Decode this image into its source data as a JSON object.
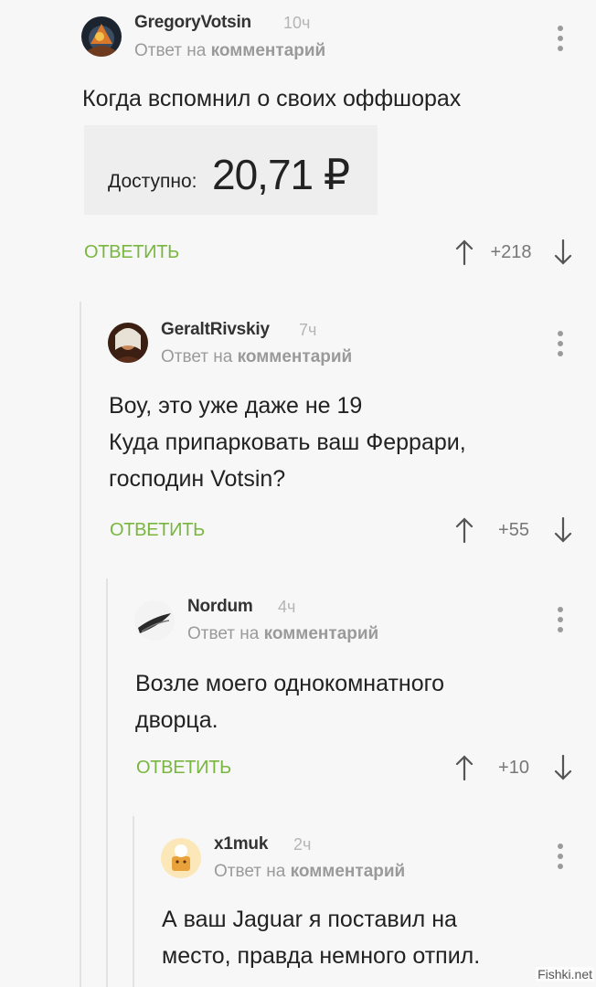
{
  "comments": [
    {
      "username": "GregoryVotsin",
      "time": "10ч",
      "reply_prefix": "Ответ на",
      "reply_target": "комментарий",
      "text_lines": [
        "Когда вспомнил о своих оффшорах"
      ],
      "reply_label": "ОТВЕТИТЬ",
      "score": "+218",
      "attachment": {
        "label": "Доступно:",
        "value": "20,71 ₽"
      }
    },
    {
      "username": "GeraltRivskiy",
      "time": "7ч",
      "reply_prefix": "Ответ на",
      "reply_target": "комментарий",
      "text_lines": [
        "Воу, это уже даже не 19",
        "Куда припарковать ваш Феррари,",
        "господин Votsin?"
      ],
      "reply_label": "ОТВЕТИТЬ",
      "score": "+55"
    },
    {
      "username": "Nordum",
      "time": "4ч",
      "reply_prefix": "Ответ на",
      "reply_target": "комментарий",
      "text_lines": [
        "Возле моего однокомнатного",
        "дворца."
      ],
      "reply_label": "ОТВЕТИТЬ",
      "score": "+10"
    },
    {
      "username": "x1muk",
      "time": "2ч",
      "reply_prefix": "Ответ на",
      "reply_target": "комментарий",
      "text_lines": [
        "А ваш Jaguar я поставил на",
        "место, правда немного отпил."
      ]
    }
  ],
  "watermark": "Fishki.net",
  "colors": {
    "accent_green": "#78b63f",
    "background": "#f7f7f7",
    "meta_gray": "#9a9a9a"
  }
}
